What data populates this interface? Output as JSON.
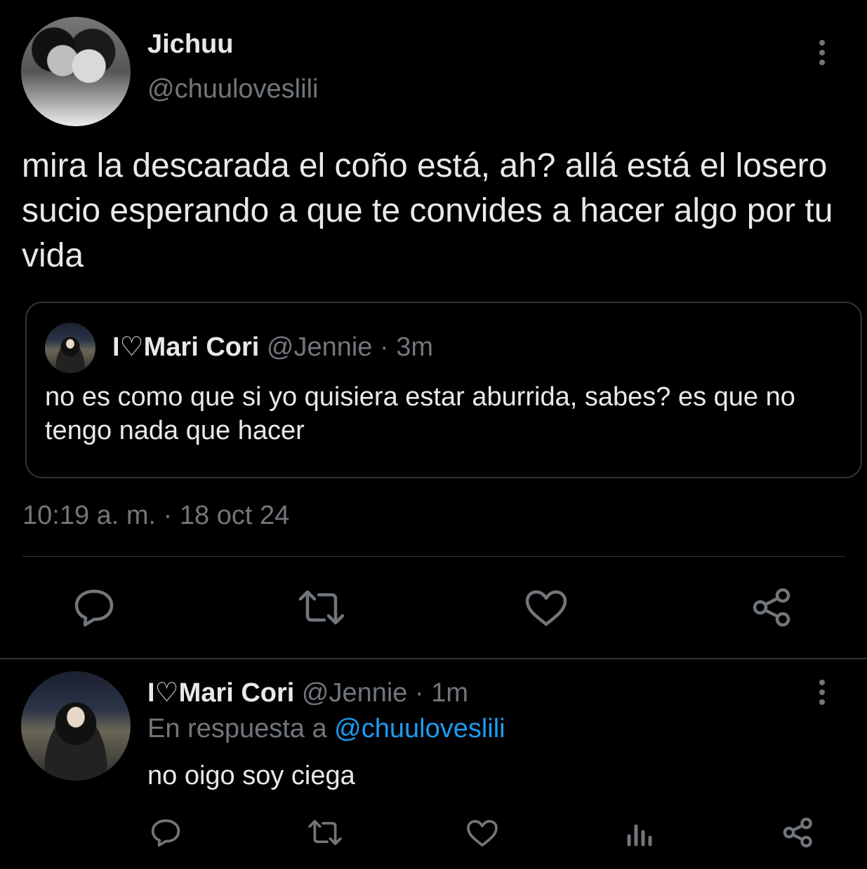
{
  "tweet": {
    "author_name": "Jichuu",
    "author_handle": "@chuuloveslili",
    "text": "mira la descarada el coño está, ah? allá está el losero sucio esperando a que te convides a hacer algo por tu vida",
    "timestamp": "10:19 a. m. · 18 oct 24",
    "quote": {
      "author_name": "I♡Mari Cori",
      "author_handle": "@Jennie",
      "time_ago": "· 3m",
      "text": "no es como que si yo quisiera estar aburrida, sabes? es que no tengo nada que hacer"
    },
    "actions": [
      "reply-icon",
      "retweet-icon",
      "like-icon",
      "share-icon"
    ]
  },
  "reply": {
    "author_name": "I♡Mari Cori",
    "author_handle": "@Jennie",
    "time_ago": "· 1m",
    "replying_to_prefix": "En respuesta a",
    "replying_to_handle": "@chuuloveslili",
    "text": "no oigo soy ciega",
    "actions": [
      "reply-icon",
      "retweet-icon",
      "like-icon",
      "views-icon",
      "share-icon"
    ]
  },
  "colors": {
    "background": "#000000",
    "text_primary": "#e7e9ea",
    "text_muted": "#71767b",
    "link": "#1d9bf0",
    "border": "#2f3336"
  }
}
